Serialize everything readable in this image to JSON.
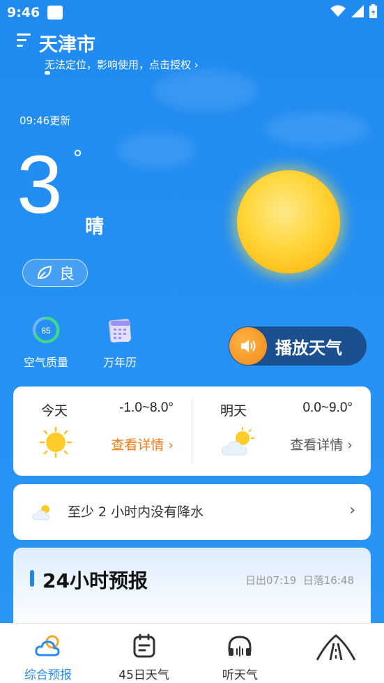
{
  "status_bar": {
    "time": "9:46"
  },
  "header": {
    "city": "天津市",
    "location_hint": "无法定位，影响使用，点击授权 ›"
  },
  "current": {
    "update_time": "09:46更新",
    "temperature": "3",
    "degree_symbol": "°",
    "condition": "晴",
    "air_quality": "良"
  },
  "tools": [
    {
      "label": "空气质量",
      "icon": "aqi-gauge-icon",
      "gauge_value": "85"
    },
    {
      "label": "万年历",
      "icon": "calendar-icon"
    }
  ],
  "play_button": {
    "label": "播放天气"
  },
  "days": [
    {
      "name": "今天",
      "range": "-1.0~8.0°",
      "link": "查看详情 ›",
      "link_color": "#f07b1a",
      "icon": "sunny-icon"
    },
    {
      "name": "明天",
      "range": "0.0~9.0°",
      "link": "查看详情 ›",
      "link_color": "#555555",
      "icon": "partly-cloudy-icon"
    }
  ],
  "precip": {
    "text": "至少 2 小时内没有降水",
    "chevron": "›"
  },
  "forecast24": {
    "title": "24小时预报",
    "sunrise": "日出07:19",
    "sunset": "日落16:48"
  },
  "tabs": [
    {
      "label": "综合预报",
      "icon": "cloud-sun-icon",
      "active": true
    },
    {
      "label": "45日天气",
      "icon": "calendar-45-icon",
      "active": false
    },
    {
      "label": "听天气",
      "icon": "headphones-icon",
      "active": false
    },
    {
      "label": "",
      "icon": "road-icon",
      "active": false
    }
  ],
  "colors": {
    "accent": "#2a8cf0",
    "background": "#2590f3",
    "play_button_bg": "#1b4f8f",
    "sun": "#ffd63a"
  }
}
